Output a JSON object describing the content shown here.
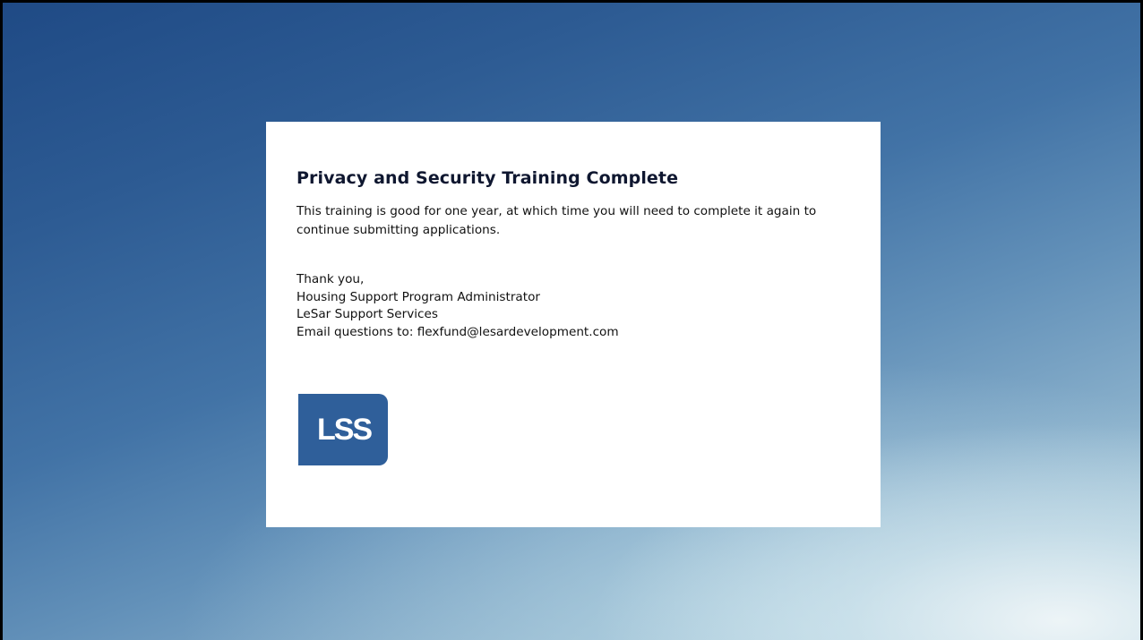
{
  "dialog": {
    "title": "Privacy and Security Training Complete",
    "message": "This training is good for one year, at which time you will need to complete it again to continue submitting applications.",
    "signature": {
      "closing": "Thank you,",
      "role": "Housing Support Program Administrator",
      "organization": "LeSar Support Services",
      "email_line": "Email questions to: flexfund@lesardevelopment.com"
    },
    "logo_text": "LSS"
  },
  "colors": {
    "logo_blue": "#2f5f9a",
    "title_text": "#0f1730",
    "background_top": "#1f4a85",
    "background_bottom": "#b6d3df"
  }
}
